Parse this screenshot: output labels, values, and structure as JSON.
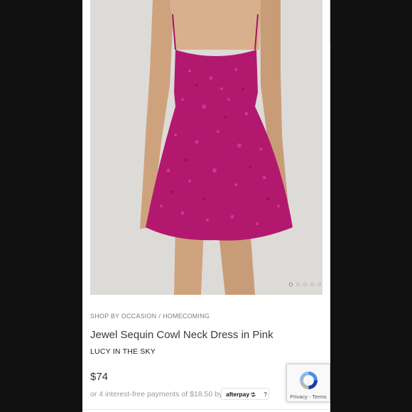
{
  "breadcrumb": {
    "parent": "SHOP BY OCCASION",
    "separator": "/",
    "current": "HOMECOMING"
  },
  "product": {
    "title": "Jewel Sequin Cowl Neck Dress in Pink",
    "brand": "LUCY IN THE SKY",
    "price": "$74",
    "installments_text": "or 4 interest-free payments of $18.50 by",
    "image_alt": "pink sequin dress photo"
  },
  "carousel": {
    "total_slides": 5,
    "active_index": 0
  },
  "afterpay": {
    "logo_text": "afterpay",
    "logo_icon": "afterpay-arrows-icon",
    "help_label": "?"
  },
  "recaptcha": {
    "privacy_label": "Privacy",
    "separator": "-",
    "terms_label": "Terms"
  },
  "colors": {
    "dress": "#b3186f",
    "dress_highlight": "#e03e9a",
    "skin": "#d9b08c",
    "background": "#dcdad7",
    "text": "#3a3a3a",
    "muted_text": "#7d7d7d"
  }
}
